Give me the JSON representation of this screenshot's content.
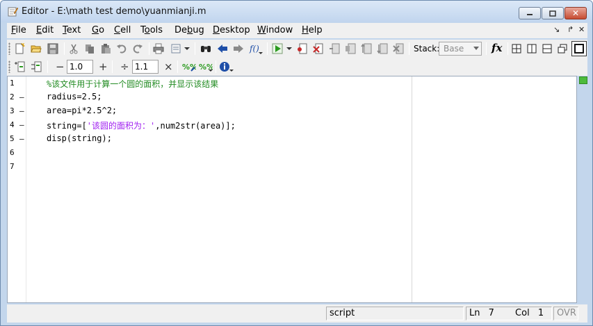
{
  "window": {
    "title": "Editor - E:\\math test demo\\yuanmianji.m"
  },
  "menu": {
    "items": [
      {
        "label": "File",
        "mnemonic": "F",
        "rest": "ile"
      },
      {
        "label": "Edit",
        "mnemonic": "E",
        "rest": "dit"
      },
      {
        "label": "Text",
        "mnemonic": "T",
        "rest": "ext"
      },
      {
        "label": "Go",
        "mnemonic": "G",
        "rest": "o"
      },
      {
        "label": "Cell",
        "mnemonic": "C",
        "rest": "ell"
      },
      {
        "label": "Tools",
        "mnemonic": "o",
        "pre": "T",
        "rest": "ols"
      },
      {
        "label": "Debug",
        "mnemonic": "b",
        "pre": "De",
        "rest": "ug"
      },
      {
        "label": "Desktop",
        "mnemonic": "D",
        "rest": "esktop"
      },
      {
        "label": "Window",
        "mnemonic": "W",
        "rest": "indow"
      },
      {
        "label": "Help",
        "mnemonic": "H",
        "rest": "elp"
      }
    ]
  },
  "toolbar": {
    "stack_label": "Stack:",
    "stack_value": "Base",
    "fx_label": "fx"
  },
  "cell_toolbar": {
    "minus": "−",
    "value1": "1.0",
    "plus": "+",
    "divide": "÷",
    "value2": "1.1",
    "times": "×"
  },
  "editor": {
    "lines": [
      {
        "num": "1",
        "marker": "",
        "text": "%该文件用于计算一个圆的面积，并显示该结果",
        "kind": "comment"
      },
      {
        "num": "2",
        "marker": "–",
        "text": "radius=2.5;",
        "kind": "code"
      },
      {
        "num": "3",
        "marker": "–",
        "text": "area=pi*2.5^2;",
        "kind": "code"
      },
      {
        "num": "4",
        "marker": "–",
        "pre": "string=[",
        "str": "'该圆的面积为：'",
        "post": ",num2str(area)];",
        "kind": "mixed"
      },
      {
        "num": "5",
        "marker": "–",
        "text": "disp(string);",
        "kind": "code"
      },
      {
        "num": "6",
        "marker": "",
        "text": "",
        "kind": "code"
      },
      {
        "num": "7",
        "marker": "",
        "text": "",
        "kind": "code"
      }
    ]
  },
  "status": {
    "mode": "script",
    "ln_label": "Ln",
    "ln_value": "7",
    "col_label": "Col",
    "col_value": "1",
    "ovr": "OVR"
  }
}
